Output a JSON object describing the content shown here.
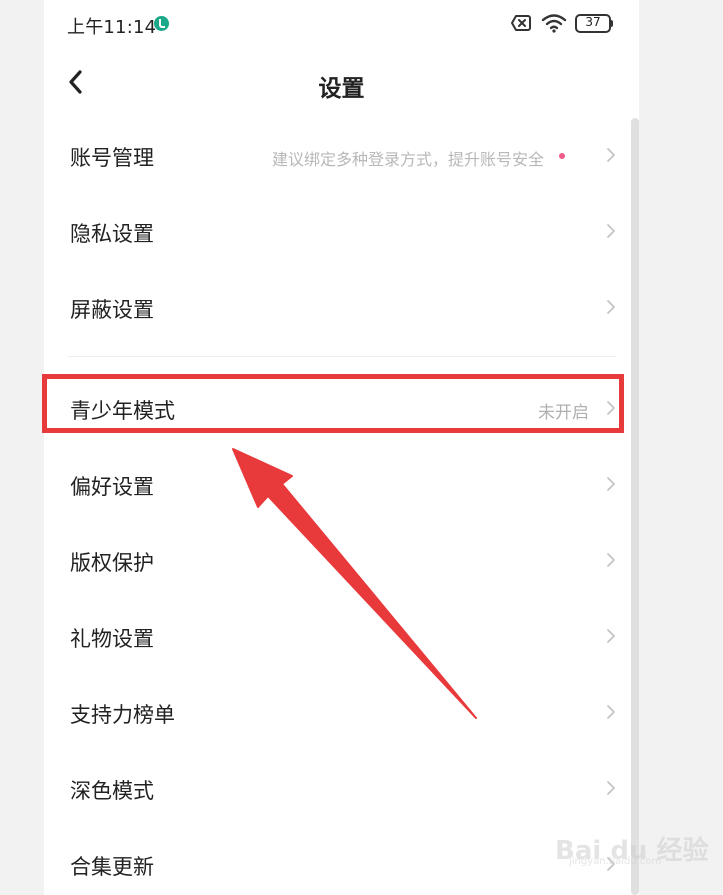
{
  "status_bar": {
    "time": "上午11:14",
    "battery": "37"
  },
  "header": {
    "title": "设置"
  },
  "settings": {
    "items": [
      {
        "label": "账号管理",
        "hint": "建议绑定多种登录方式，提升账号安全",
        "has_dot": true
      },
      {
        "label": "隐私设置"
      },
      {
        "label": "屏蔽设置"
      },
      {
        "label": "青少年模式",
        "value": "未开启"
      },
      {
        "label": "偏好设置"
      },
      {
        "label": "版权保护"
      },
      {
        "label": "礼物设置"
      },
      {
        "label": "支持力榜单"
      },
      {
        "label": "深色模式"
      },
      {
        "label": "合集更新"
      }
    ]
  },
  "watermark": {
    "text": "Bai du 经验",
    "sub": "jingyan.baidu.com"
  },
  "colors": {
    "highlight": "#e8393b",
    "dot": "#f05b8a",
    "status_icon": "#1aa889"
  }
}
